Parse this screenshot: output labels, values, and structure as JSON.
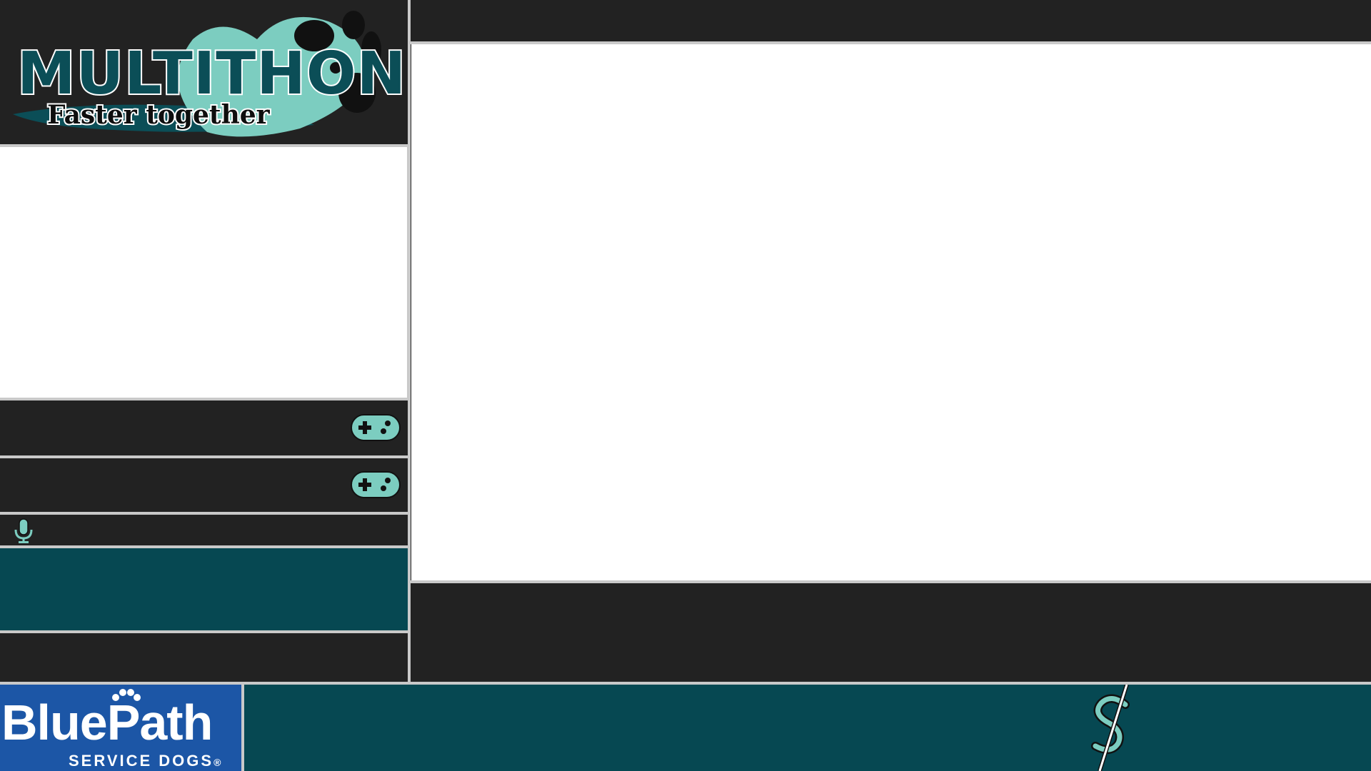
{
  "logo": {
    "title": "MULTITHON",
    "tagline": "Faster together",
    "colors": {
      "teal": "#7ccdc0",
      "dark_teal": "#0b4e57"
    }
  },
  "runners": [
    {
      "icon": "controller-icon"
    },
    {
      "icon": "controller-icon"
    }
  ],
  "commentary": {
    "icon": "microphone-icon"
  },
  "sponsor": {
    "name": "BluePath",
    "subtitle": "SERVICE DOGS",
    "registered": "®",
    "color": "#1c56a6"
  },
  "footer": {
    "icon": "dollar-icon",
    "color": "#064852"
  },
  "colors": {
    "background": "#222222",
    "panel_border": "#c9c9c9",
    "accent_teal": "#064852",
    "icon_teal": "#7ccdc0"
  }
}
